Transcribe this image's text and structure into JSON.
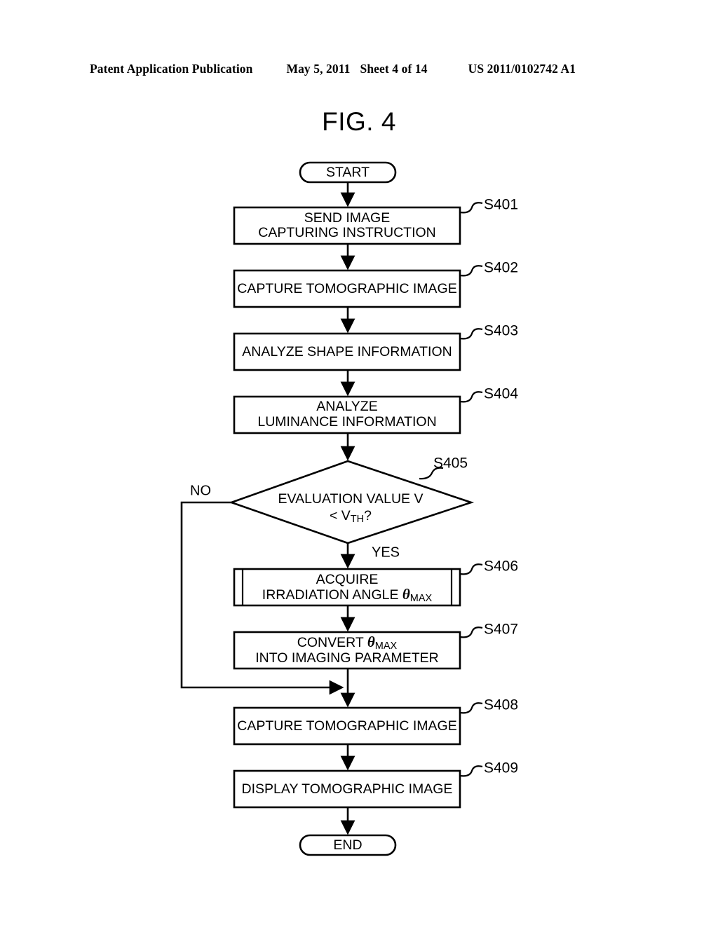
{
  "header": {
    "publication": "Patent Application Publication",
    "date": "May 5, 2011",
    "sheet": "Sheet 4 of 14",
    "document_number": "US 2011/0102742 A1"
  },
  "figure": {
    "title": "FIG. 4"
  },
  "flowchart": {
    "start_label": "START",
    "end_label": "END",
    "branch_no": "NO",
    "branch_yes": "YES",
    "steps": [
      {
        "id": "S401",
        "shape": "process",
        "lines": [
          "SEND IMAGE",
          "CAPTURING INSTRUCTION"
        ]
      },
      {
        "id": "S402",
        "shape": "process",
        "lines": [
          "CAPTURE TOMOGRAPHIC IMAGE"
        ]
      },
      {
        "id": "S403",
        "shape": "process",
        "lines": [
          "ANALYZE SHAPE INFORMATION"
        ]
      },
      {
        "id": "S404",
        "shape": "process",
        "lines": [
          "ANALYZE",
          "LUMINANCE INFORMATION"
        ]
      },
      {
        "id": "S405",
        "shape": "decision",
        "lines": [
          "EVALUATION VALUE V",
          "< VTH?"
        ]
      },
      {
        "id": "S406",
        "shape": "predefined-process",
        "lines": [
          "ACQUIRE",
          "IRRADIATION ANGLE θMAX"
        ]
      },
      {
        "id": "S407",
        "shape": "process",
        "lines": [
          "CONVERT θMAX",
          "INTO IMAGING PARAMETER"
        ]
      },
      {
        "id": "S408",
        "shape": "process",
        "lines": [
          "CAPTURE TOMOGRAPHIC IMAGE"
        ]
      },
      {
        "id": "S409",
        "shape": "process",
        "lines": [
          "DISPLAY TOMOGRAPHIC IMAGE"
        ]
      }
    ],
    "text_parts": {
      "s405_line1": "EVALUATION VALUE V",
      "s405_lt": "< V",
      "s405_sub": "TH",
      "s405_q": "?",
      "s406_line1": "ACQUIRE",
      "s406_pre": "IRRADIATION ANGLE ",
      "s406_theta": "θ",
      "s406_sub": "MAX",
      "s407_pre": "CONVERT ",
      "s407_theta": "θ",
      "s407_sub": "MAX",
      "s407_line2": "INTO IMAGING PARAMETER",
      "s401_line1": "SEND IMAGE",
      "s401_line2": "CAPTURING INSTRUCTION",
      "s402_line1": "CAPTURE TOMOGRAPHIC IMAGE",
      "s403_line1": "ANALYZE SHAPE INFORMATION",
      "s404_line1": "ANALYZE",
      "s404_line2": "LUMINANCE INFORMATION",
      "s408_line1": "CAPTURE TOMOGRAPHIC IMAGE",
      "s409_line1": "DISPLAY TOMOGRAPHIC IMAGE"
    },
    "step_ids": {
      "s401": "S401",
      "s402": "S402",
      "s403": "S403",
      "s404": "S404",
      "s405": "S405",
      "s406": "S406",
      "s407": "S407",
      "s408": "S408",
      "s409": "S409"
    }
  },
  "colors": {
    "ink": "#000000",
    "paper": "#ffffff"
  }
}
